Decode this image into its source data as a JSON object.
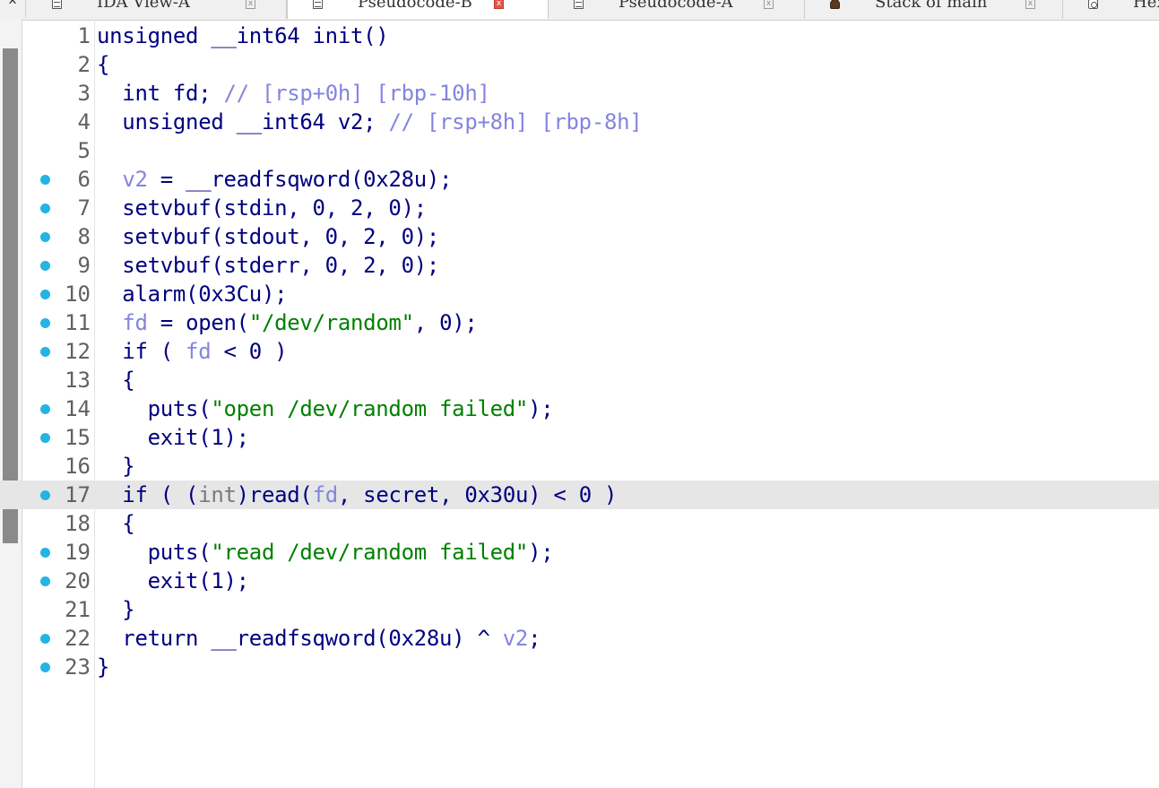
{
  "tabs": [
    {
      "label": "IDA View-A",
      "icon": "document-icon",
      "active": false
    },
    {
      "label": "Pseudocode-B",
      "icon": "document-icon",
      "active": true
    },
    {
      "label": "Pseudocode-A",
      "icon": "document-icon",
      "active": false
    },
    {
      "label": "Stack of main",
      "icon": "stack-icon",
      "active": false
    },
    {
      "label": "Hex",
      "icon": "hex-icon",
      "active": false
    }
  ],
  "collapse_glyph": "^",
  "close_glyph": "x",
  "current_line": 17,
  "colors": {
    "plain": "#000080",
    "type_keyword": "#7a7a7a",
    "variable": "#8484e0",
    "string": "#008000",
    "breakpoint_dot": "#23b4e3",
    "current_line_bg": "#e6e6e6",
    "active_tab_close": "#e2574c"
  },
  "lines": [
    {
      "num": "1",
      "dot": false,
      "tokens": [
        [
          "p",
          "unsigned __int64 init()"
        ]
      ]
    },
    {
      "num": "2",
      "dot": false,
      "tokens": [
        [
          "p",
          "{"
        ]
      ]
    },
    {
      "num": "3",
      "dot": false,
      "tokens": [
        [
          "p",
          "  int fd; "
        ],
        [
          "v",
          "// [rsp+0h] [rbp-10h]"
        ]
      ]
    },
    {
      "num": "4",
      "dot": false,
      "tokens": [
        [
          "p",
          "  unsigned __int64 v2; "
        ],
        [
          "v",
          "// [rsp+8h] [rbp-8h]"
        ]
      ]
    },
    {
      "num": "5",
      "dot": false,
      "tokens": []
    },
    {
      "num": "6",
      "dot": true,
      "tokens": [
        [
          "p",
          "  "
        ],
        [
          "v",
          "v2"
        ],
        [
          "p",
          " = __readfsqword(0x28u);"
        ]
      ]
    },
    {
      "num": "7",
      "dot": true,
      "tokens": [
        [
          "p",
          "  setvbuf(stdin, 0, 2, 0);"
        ]
      ]
    },
    {
      "num": "8",
      "dot": true,
      "tokens": [
        [
          "p",
          "  setvbuf(stdout, 0, 2, 0);"
        ]
      ]
    },
    {
      "num": "9",
      "dot": true,
      "tokens": [
        [
          "p",
          "  setvbuf(stderr, 0, 2, 0);"
        ]
      ]
    },
    {
      "num": "10",
      "dot": true,
      "tokens": [
        [
          "p",
          "  alarm(0x3Cu);"
        ]
      ]
    },
    {
      "num": "11",
      "dot": true,
      "tokens": [
        [
          "p",
          "  "
        ],
        [
          "v",
          "fd"
        ],
        [
          "p",
          " = open("
        ],
        [
          "s",
          "\"/dev/random\""
        ],
        [
          "p",
          ", 0);"
        ]
      ]
    },
    {
      "num": "12",
      "dot": true,
      "tokens": [
        [
          "p",
          "  if ( "
        ],
        [
          "v",
          "fd"
        ],
        [
          "p",
          " < 0 )"
        ]
      ]
    },
    {
      "num": "13",
      "dot": false,
      "tokens": [
        [
          "p",
          "  {"
        ]
      ]
    },
    {
      "num": "14",
      "dot": true,
      "tokens": [
        [
          "p",
          "    puts("
        ],
        [
          "s",
          "\"open /dev/random failed\""
        ],
        [
          "p",
          ");"
        ]
      ]
    },
    {
      "num": "15",
      "dot": true,
      "tokens": [
        [
          "p",
          "    exit(1);"
        ]
      ]
    },
    {
      "num": "16",
      "dot": false,
      "tokens": [
        [
          "p",
          "  }"
        ]
      ]
    },
    {
      "num": "17",
      "dot": true,
      "tokens": [
        [
          "p",
          "  if ( ("
        ],
        [
          "g",
          "int"
        ],
        [
          "p",
          ")read("
        ],
        [
          "v",
          "fd"
        ],
        [
          "p",
          ", secret, 0x30u) < 0 )"
        ]
      ]
    },
    {
      "num": "18",
      "dot": false,
      "tokens": [
        [
          "p",
          "  {"
        ]
      ]
    },
    {
      "num": "19",
      "dot": true,
      "tokens": [
        [
          "p",
          "    puts("
        ],
        [
          "s",
          "\"read /dev/random failed\""
        ],
        [
          "p",
          ");"
        ]
      ]
    },
    {
      "num": "20",
      "dot": true,
      "tokens": [
        [
          "p",
          "    exit(1);"
        ]
      ]
    },
    {
      "num": "21",
      "dot": false,
      "tokens": [
        [
          "p",
          "  }"
        ]
      ]
    },
    {
      "num": "22",
      "dot": true,
      "tokens": [
        [
          "p",
          "  return __readfsqword(0x28u) ^ "
        ],
        [
          "v",
          "v2"
        ],
        [
          "p",
          ";"
        ]
      ]
    },
    {
      "num": "23",
      "dot": true,
      "tokens": [
        [
          "p",
          "}"
        ]
      ]
    }
  ]
}
